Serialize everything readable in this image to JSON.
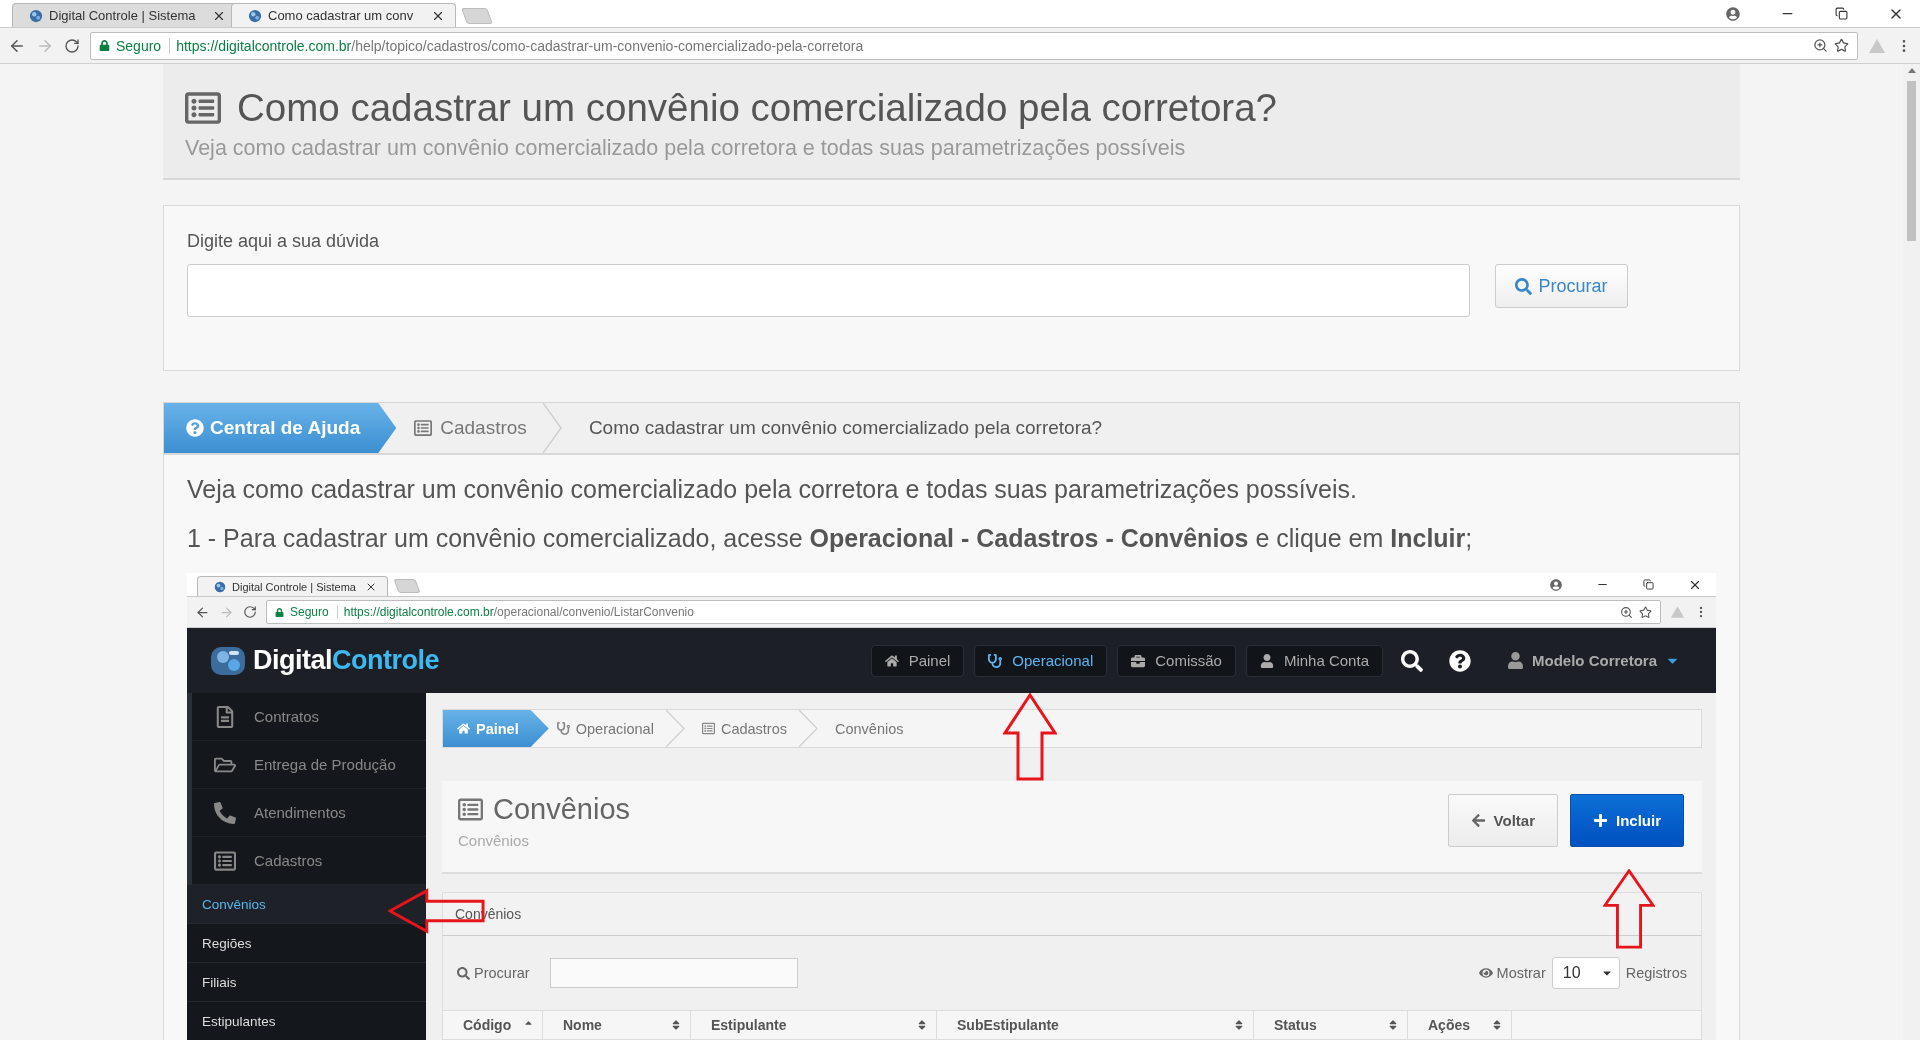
{
  "browser": {
    "tabs": [
      {
        "title": "Digital Controle | Sistema",
        "selected": false
      },
      {
        "title": "Como cadastrar um conv",
        "selected": true
      }
    ],
    "address": {
      "security": "Seguro",
      "host": "https://digitalcontrole.com.br",
      "path": "/help/topico/cadastros/como-cadastrar-um-convenio-comercializado-pela-corretora"
    }
  },
  "header": {
    "title": "Como cadastrar um convênio comercializado pela corretora?",
    "subtitle": "Veja como cadastrar um convênio comercializado pela corretora e todas suas parametrizações possíveis"
  },
  "search": {
    "label": "Digite aqui a sua dúvida",
    "button": "Procurar"
  },
  "breadcrumb": [
    {
      "label": "Central de Ajuda",
      "selected": true
    },
    {
      "label": "Cadastros",
      "selected": false
    },
    {
      "label": "Como cadastrar um convênio comercializado pela corretora?",
      "selected": false
    }
  ],
  "article": {
    "paragraphs": [
      "Veja como cadastrar um convênio comercializado pela corretora e todas suas parametrizações possíveis.",
      "1 - Para cadastrar um convênio comercializado, acesse **Operacional - Cadastros - Convênios** e clique em **Incluir**;"
    ]
  },
  "screenshot": {
    "browser": {
      "tabs": [
        {
          "title": "Digital Controle | Sistema",
          "selected": true
        }
      ],
      "address": {
        "security": "Seguro",
        "host": "https://digitalcontrole.com.br",
        "path": "/operacional/convenio/ListarConvenio"
      }
    },
    "logo": {
      "first": "Digital",
      "second": "Controle"
    },
    "nav": [
      {
        "label": "Painel",
        "kind": "home",
        "selected": false
      },
      {
        "label": "Operacional",
        "kind": "stethoscope",
        "selected": true
      },
      {
        "label": "Comissão",
        "kind": "briefcase",
        "selected": false
      },
      {
        "label": "Minha Conta",
        "kind": "user",
        "selected": false
      }
    ],
    "user": "Modelo Corretora",
    "sidebar": [
      {
        "label": "Contratos",
        "kind": "file",
        "selected": false
      },
      {
        "label": "Entrega de Produção",
        "kind": "folder",
        "selected": false
      },
      {
        "label": "Atendimentos",
        "kind": "phone",
        "selected": false
      },
      {
        "label": "Cadastros",
        "kind": "list",
        "selected": false
      },
      {
        "label": "Convênios",
        "kind": "sub",
        "selected": true
      },
      {
        "label": "Regiões",
        "kind": "sub",
        "selected": false
      },
      {
        "label": "Filiais",
        "kind": "sub",
        "selected": false
      },
      {
        "label": "Estipulantes",
        "kind": "sub",
        "selected": false
      }
    ],
    "breadcrumb": [
      {
        "label": "Painel",
        "kind": "home",
        "selected": true
      },
      {
        "label": "Operacional",
        "kind": "stethoscope",
        "selected": false
      },
      {
        "label": "Cadastros",
        "kind": "list",
        "selected": false
      },
      {
        "label": "Convênios",
        "kind": "none",
        "selected": false
      }
    ],
    "title": "Convênios",
    "subtitle": "Convênios",
    "buttons": [
      {
        "label": "Voltar",
        "kind": "back"
      },
      {
        "label": "Incluir",
        "kind": "add"
      }
    ],
    "panel_title": "Convênios",
    "search_label": "Procurar",
    "show_label": "Mostrar",
    "page_size": "10",
    "page_size_suffix": "Registros",
    "columns": [
      {
        "label": "Código",
        "sorted": true
      },
      {
        "label": "Nome",
        "sorted": false
      },
      {
        "label": "Estipulante",
        "sorted": false
      },
      {
        "label": "SubEstipulante",
        "sorted": false
      },
      {
        "label": "Status",
        "sorted": false
      },
      {
        "label": "Ações",
        "sorted": false
      }
    ]
  },
  "annotations": [
    {
      "kind": "up"
    },
    {
      "kind": "left"
    },
    {
      "kind": "up"
    }
  ]
}
